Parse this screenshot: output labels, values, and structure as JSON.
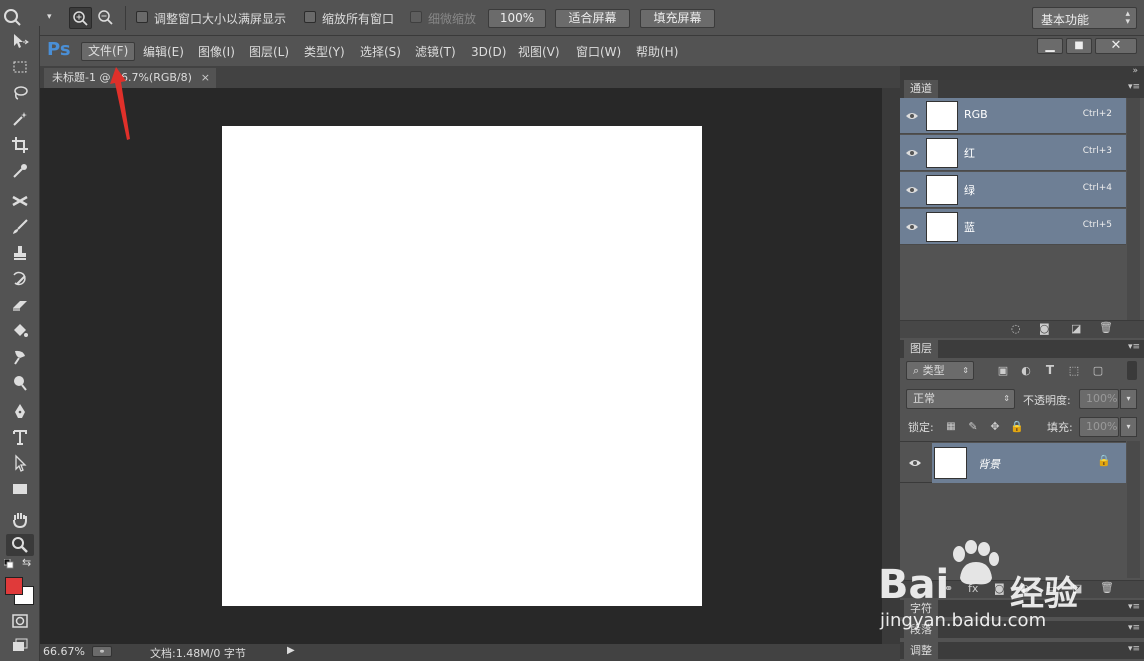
{
  "options_bar": {
    "resize_windows_label": "调整窗口大小以满屏显示",
    "zoom_all_label": "缩放所有窗口",
    "scrubby_zoom_label": "细微缩放",
    "zoom100_label": "100%",
    "fit_screen_label": "适合屏幕",
    "fill_screen_label": "填充屏幕",
    "workspace_value": "基本功能"
  },
  "menubar": {
    "logo": "Ps",
    "items": [
      "文件(F)",
      "编辑(E)",
      "图像(I)",
      "图层(L)",
      "类型(Y)",
      "选择(S)",
      "滤镜(T)",
      "3D(D)",
      "视图(V)",
      "窗口(W)",
      "帮助(H)"
    ]
  },
  "document": {
    "tab_title": "未标题-1 @ 66.7%(RGB/8)",
    "close_symbol": "×",
    "zoom_level": "66.67%",
    "doc_info": "文档:1.48M/0 字节"
  },
  "channels_panel": {
    "title": "通道",
    "channels": [
      {
        "name": "RGB",
        "shortcut": "Ctrl+2"
      },
      {
        "name": "红",
        "shortcut": "Ctrl+3"
      },
      {
        "name": "绿",
        "shortcut": "Ctrl+4"
      },
      {
        "name": "蓝",
        "shortcut": "Ctrl+5"
      }
    ]
  },
  "layers_panel": {
    "title": "图层",
    "filter_type": "类型",
    "blend_mode": "正常",
    "opacity_label": "不透明度:",
    "opacity_value": "100%",
    "lock_label": "锁定:",
    "fill_label": "填充:",
    "fill_value": "100%",
    "layer_name": "背景"
  },
  "collapsed_panels": [
    "字符",
    "段落",
    "调整"
  ],
  "watermark": {
    "brand": "Bai",
    "brand2": "经验",
    "url": "jingyan.baidu.com"
  },
  "colors": {
    "foreground": "#e03a3a",
    "background": "#ffffff",
    "selected_row": "#6e7f95",
    "arrow": "#e0302a"
  }
}
